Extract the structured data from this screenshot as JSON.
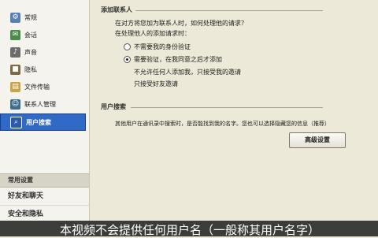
{
  "sidebar": {
    "items": [
      {
        "label": "常规",
        "icon": "settings-icon",
        "color": "#5a7fb5"
      },
      {
        "label": "会话",
        "icon": "chat-icon",
        "color": "#4a8b4c"
      },
      {
        "label": "声音",
        "icon": "sound-icon",
        "color": "#6b6b6b"
      },
      {
        "label": "隐私",
        "icon": "privacy-icon",
        "color": "#7a6b45"
      },
      {
        "label": "文件传输",
        "icon": "folder-icon",
        "color": "#c9a34a"
      },
      {
        "label": "联系人管理",
        "icon": "contacts-icon",
        "color": "#3d6e8f"
      },
      {
        "label": "用户搜索",
        "icon": "search-user-icon",
        "color": "#2a5aa8",
        "active": true
      }
    ],
    "footer": {
      "header": "常用设置",
      "rows": [
        "好友和聊天",
        "安全和隐私"
      ]
    }
  },
  "section1": {
    "title": "添加联系人",
    "lines": [
      "在对方将您加为联系人时，如何处理他的请求？",
      "在处理他人的添加请求时：",
      "不需要我的身份验证",
      "需要验证，在我同意之后才添加",
      "不允许任何人添加我，只接受我的邀请",
      "只接受好友邀请"
    ]
  },
  "section2": {
    "title": "用户搜索",
    "desc": "其他用户在通讯录中搜索时，是否能找到我的名字。您也可以选择隐藏您的信息（推荐）",
    "button": "高级设置"
  },
  "banner": {
    "text": "本视频不会提供任何用户名（一般称其用户名字）"
  },
  "colors": {
    "accent": "#3169c6",
    "background": "#ece9d8"
  }
}
